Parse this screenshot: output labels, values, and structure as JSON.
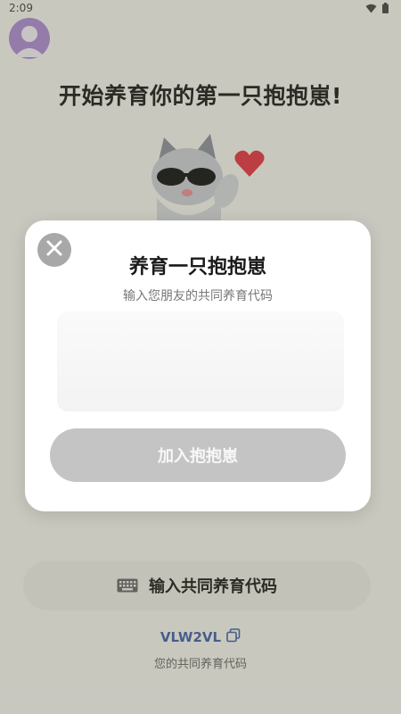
{
  "status_bar": {
    "time": "2:09",
    "icons": [
      "wifi-icon",
      "battery-icon"
    ]
  },
  "header": {
    "title": "开始养育你的第一只抱抱崽!"
  },
  "mascot": {
    "icon": "cat-with-sunglasses",
    "heart_icon": "heart-icon"
  },
  "bottom": {
    "code_button_label": "输入共同养育代码",
    "share_code": "VLW2VL",
    "share_code_caption": "您的共同养育代码"
  },
  "dialog": {
    "title": "养育一只抱抱崽",
    "subtitle": "输入您朋友的共同养育代码",
    "input_value": "",
    "join_button_label": "加入抱抱崽"
  },
  "colors": {
    "avatar": "#a98ad2",
    "link": "#3f5fa8",
    "disabled_button": "#c4c4c4"
  }
}
